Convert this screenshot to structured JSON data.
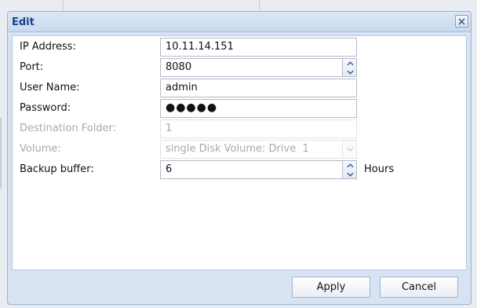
{
  "dialog": {
    "title": "Edit",
    "close_icon": "close-icon"
  },
  "fields": {
    "ip_address": {
      "label": "IP Address:",
      "value": "10.11.14.151"
    },
    "port": {
      "label": "Port:",
      "value": "8080"
    },
    "user_name": {
      "label": "User Name:",
      "value": "admin"
    },
    "password": {
      "label": "Password:",
      "value": "●●●●●"
    },
    "destination_folder": {
      "label": "Destination Folder:",
      "value": "1",
      "disabled": true
    },
    "volume": {
      "label": "Volume:",
      "value": "single Disk Volume: Drive  1",
      "disabled": true
    },
    "backup_buffer": {
      "label": "Backup buffer:",
      "value": "6",
      "unit": "Hours"
    }
  },
  "buttons": {
    "apply": "Apply",
    "cancel": "Cancel"
  },
  "colors": {
    "title_text": "#15428b",
    "frame": "#d7e3f2",
    "disabled_text": "#a9a9a9"
  }
}
